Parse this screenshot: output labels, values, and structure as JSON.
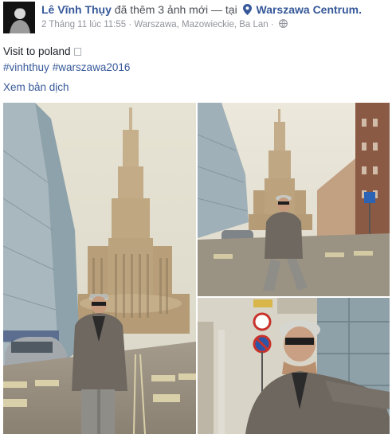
{
  "post": {
    "author": "Lê Vĩnh Thụy",
    "action": "đã thêm 3 ảnh mới",
    "separator": "— tại",
    "location": "Warszawa Centrum.",
    "timestamp": "2 Tháng 11 lúc 11:55",
    "dot": "·",
    "place_detail": "Warszawa, Mazowieckie, Ba Lan",
    "caption": "Visit to poland",
    "hashtags": [
      "#vinhthuy",
      "#warszawa2016"
    ],
    "translate_link": "Xem bản dịch"
  },
  "icons": {
    "location": "map-pin-icon",
    "audience": "globe-icon"
  },
  "colors": {
    "link": "#365899",
    "text": "#1d2129",
    "meta": "#90949c"
  }
}
